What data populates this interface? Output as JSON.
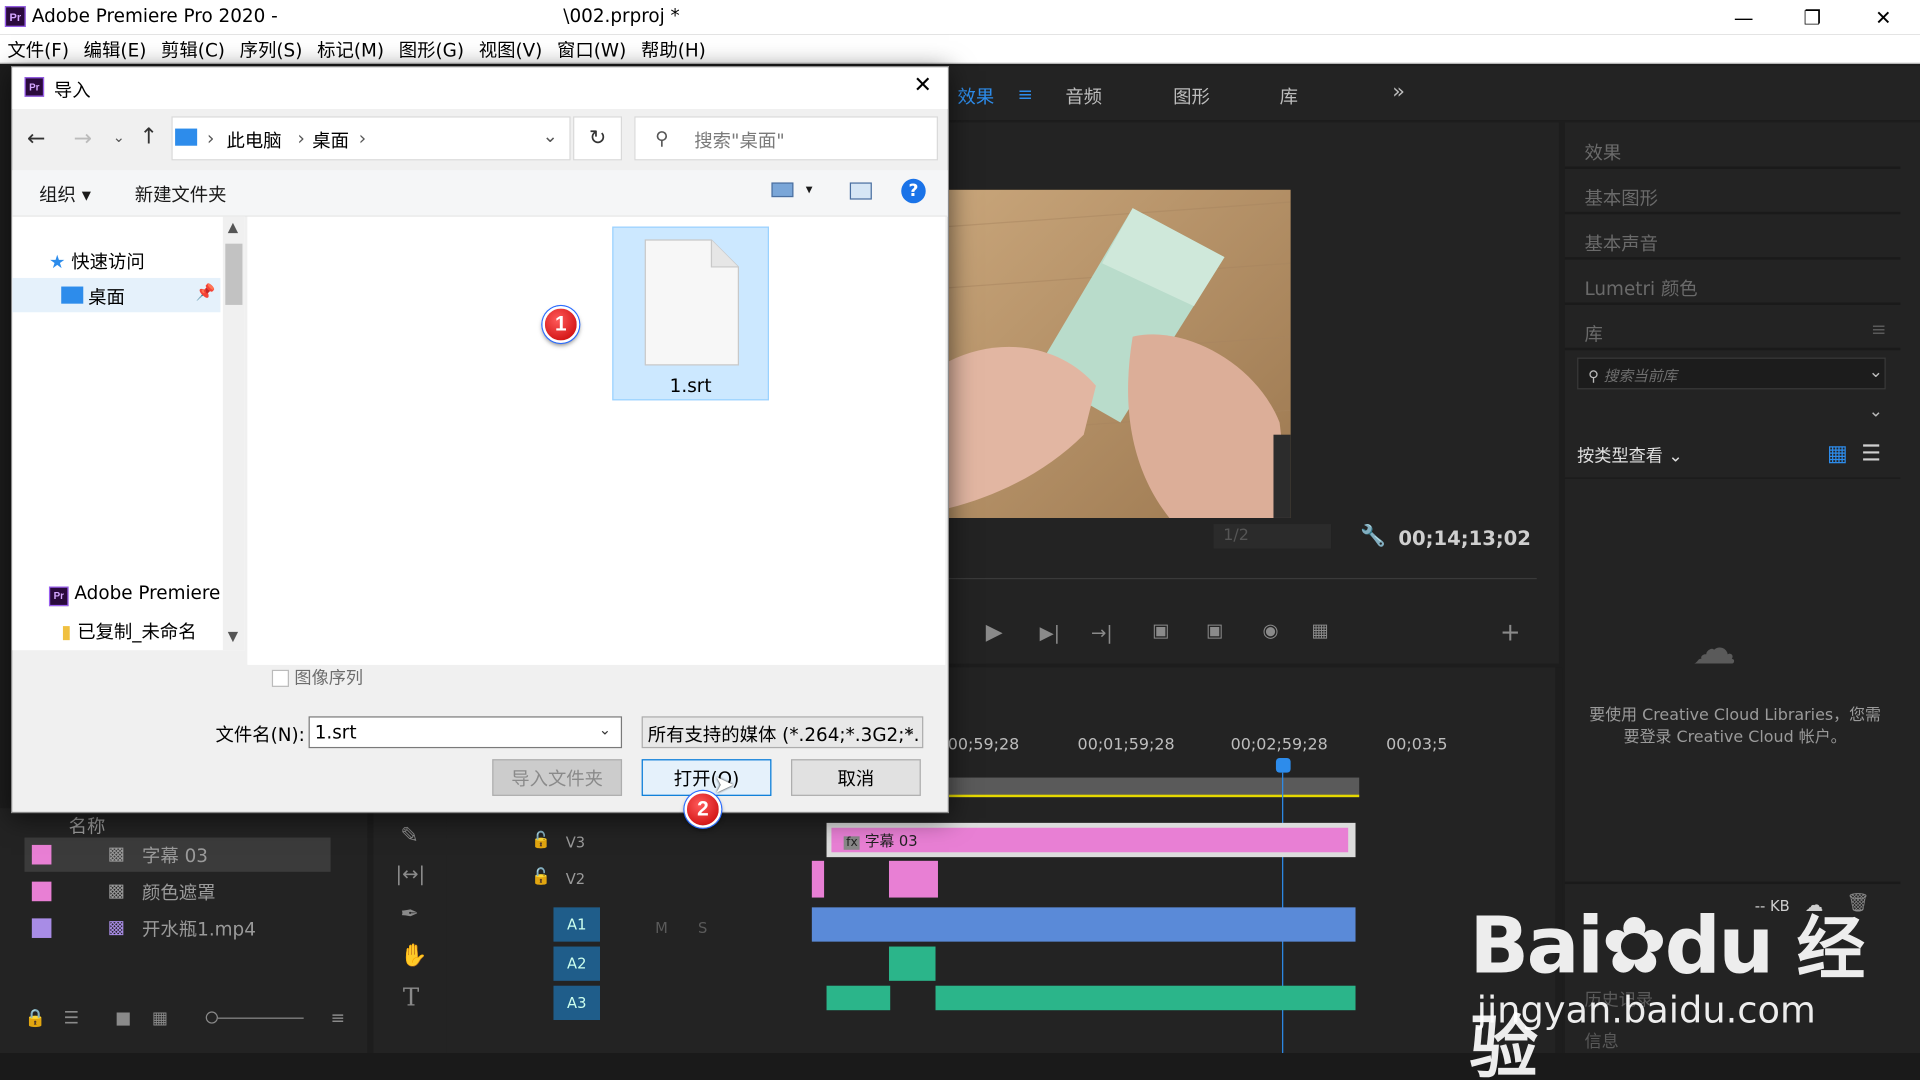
{
  "app": {
    "title": "Adobe Premiere Pro 2020 -",
    "project_file": "\\002.prproj *",
    "menu": [
      "文件(F)",
      "编辑(E)",
      "剪辑(C)",
      "序列(S)",
      "标记(M)",
      "图形(G)",
      "视图(V)",
      "窗口(W)",
      "帮助(H)"
    ]
  },
  "workspace_tabs": [
    "效果",
    "音频",
    "图形",
    "库"
  ],
  "right_panel": {
    "items": [
      "效果",
      "基本图形",
      "基本声音",
      "Lumetri 颜色",
      "库"
    ],
    "search_placeholder": "搜索当前库",
    "view_by": "按类型查看",
    "cc_message": "要使用 Creative Cloud Libraries，您需要登录 Creative Cloud 帐户。",
    "kb": "-- KB",
    "history": "历史记录",
    "info": "信息"
  },
  "preview": {
    "resolution": "1/2",
    "timecode": "00;14;13;02"
  },
  "timeline": {
    "ruler": [
      "00;59;28",
      "00;01;59;28",
      "00;02;59;28",
      "00;03;5"
    ],
    "tracks": [
      "V3",
      "V2",
      "A1",
      "A2",
      "A3"
    ],
    "title_clip": "字幕 03",
    "track_buttons": [
      "M",
      "S"
    ]
  },
  "project": {
    "header": "名称",
    "items": [
      {
        "name": "字幕 03",
        "color": "#e87fd4"
      },
      {
        "name": "颜色遮罩",
        "color": "#e87fd4"
      },
      {
        "name": "开水瓶1.mp4",
        "color": "#a88ce6"
      }
    ]
  },
  "dialog": {
    "title": "导入",
    "breadcrumb": [
      "此电脑",
      "桌面"
    ],
    "search_placeholder": "搜索\"桌面\"",
    "organize": "组织",
    "new_folder": "新建文件夹",
    "nav": {
      "quick_access": "快速访问",
      "desktop": "桌面",
      "premiere": "Adobe Premiere",
      "copied": "已复制_未命名"
    },
    "file": "1.srt",
    "image_sequence": "图像序列",
    "filename_label": "文件名(N):",
    "filename_value": "1.srt",
    "filetype": "所有支持的媒体 (*.264;*.3G2;*.",
    "import_folder": "导入文件夹",
    "open": "打开(O)",
    "cancel": "取消"
  },
  "markers": [
    "1",
    "2"
  ],
  "watermark": {
    "brand": "Bai",
    "brand2": "du",
    "cn": "经验",
    "url": "jingyan.baidu.com"
  },
  "colors": {
    "accent_blue": "#2d8ceb",
    "title_clip": "#e87fd4",
    "audio_clip": "#2bb58a",
    "selection": "#cce8ff"
  }
}
